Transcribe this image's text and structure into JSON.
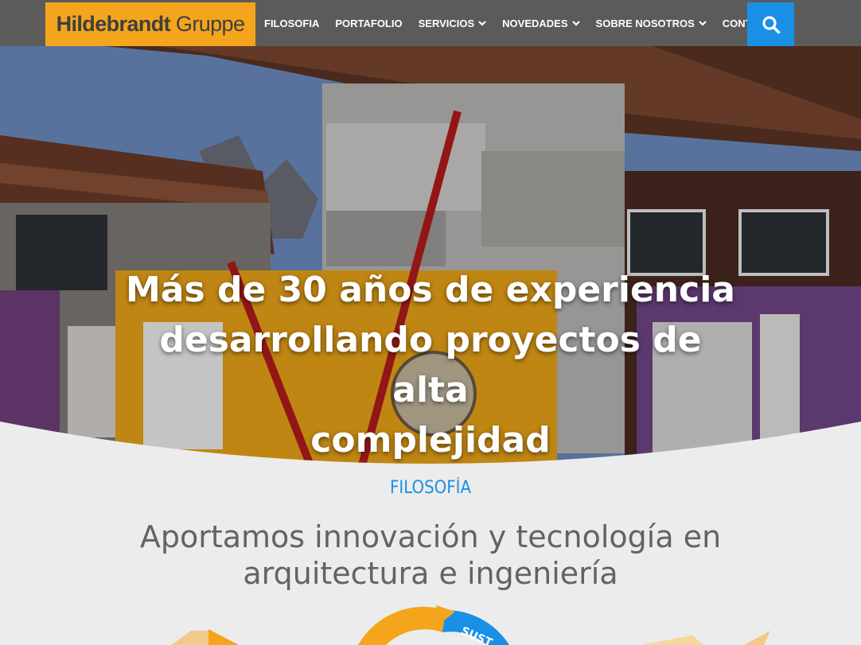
{
  "brand": {
    "name_bold": "Hildebrandt",
    "name_light": " Gruppe"
  },
  "nav": {
    "items": [
      {
        "label": "FILOSOFIA",
        "has_dropdown": false
      },
      {
        "label": "PORTAFOLIO",
        "has_dropdown": false
      },
      {
        "label": "SERVICIOS",
        "has_dropdown": true
      },
      {
        "label": "NOVEDADES",
        "has_dropdown": true
      },
      {
        "label": "SOBRE NOSOTROS",
        "has_dropdown": true
      },
      {
        "label": "CONTACTO",
        "has_dropdown": false
      }
    ],
    "search_icon": "search-icon"
  },
  "hero": {
    "title_lines": [
      "Más de 30 años de experiencia",
      "desarrollando proyectos de alta",
      "complejidad"
    ]
  },
  "section": {
    "label": "FILOSOFÍA",
    "heading_lines": [
      "Aportamos innovación y tecnología en",
      "arquitectura e ingeniería"
    ],
    "graphic_text": "SUST"
  },
  "colors": {
    "accent_orange": "#f4a51c",
    "accent_blue": "#1a8fe6",
    "header_bg": "#5b5b5b",
    "section_bg": "#ececec",
    "heading_gray": "#636363"
  }
}
